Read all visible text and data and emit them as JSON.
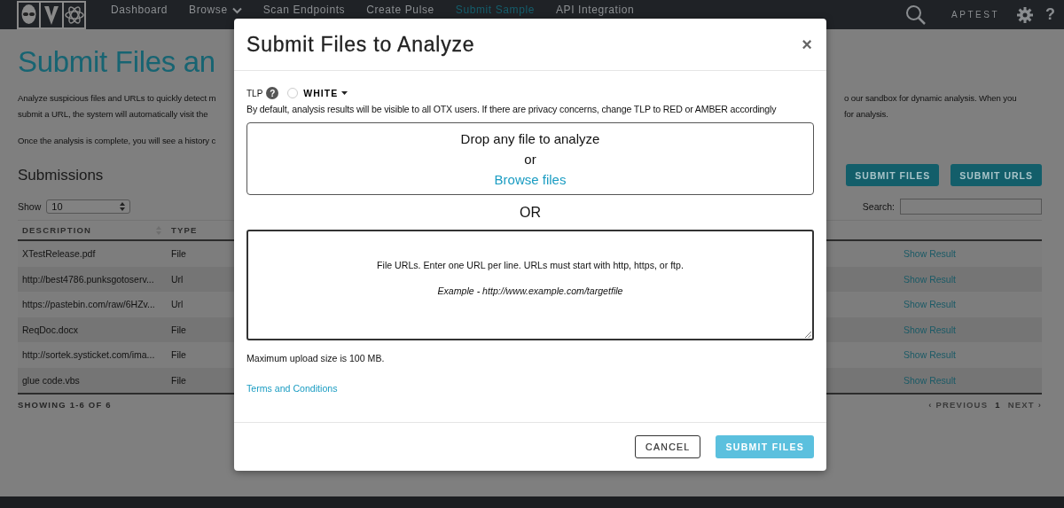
{
  "nav": {
    "items": [
      {
        "label": "Dashboard",
        "selected": false,
        "dropdown": false
      },
      {
        "label": "Browse",
        "selected": false,
        "dropdown": true
      },
      {
        "label": "Scan Endpoints",
        "selected": false,
        "dropdown": false
      },
      {
        "label": "Create Pulse",
        "selected": false,
        "dropdown": false
      },
      {
        "label": "Submit Sample",
        "selected": true,
        "dropdown": false
      },
      {
        "label": "API Integration",
        "selected": false,
        "dropdown": false
      }
    ],
    "user": "APTEST",
    "help": "?"
  },
  "page": {
    "title": "Submit Files an",
    "intro_lines": [
      {
        "left": "Analyze suspicious files and URLs to quickly detect m",
        "right": "o our sandbox for dynamic analysis. When you"
      },
      {
        "left": "submit a URL, the system will automatically visit the",
        "right": "for analysis."
      },
      {
        "left": "Once the analysis is complete, you will see a history c"
      }
    ],
    "submissions_title": "Submissions",
    "buttons": [
      "SUBMIT FILES",
      "SUBMIT URLS"
    ],
    "show_label": "Show",
    "show_value": "10",
    "search_label": "Search:",
    "table": {
      "columns": [
        "DESCRIPTION",
        "TYPE"
      ],
      "rows": [
        {
          "description": "XTestRelease.pdf",
          "type": "File",
          "action": "Show Result"
        },
        {
          "description": "http://best4786.punksgotoserv...",
          "type": "Url",
          "action": "Show Result"
        },
        {
          "description": "https://pastebin.com/raw/6HZv...",
          "type": "Url",
          "action": "Show Result"
        },
        {
          "description": "ReqDoc.docx",
          "type": "File",
          "action": "Show Result"
        },
        {
          "description": "http://sortek.systicket.com/ima...",
          "type": "File",
          "action": "Show Result"
        },
        {
          "description": "glue code.vbs",
          "type": "File",
          "action": "Show Result"
        }
      ]
    },
    "showing": "SHOWING 1-6 OF 6",
    "pagination": {
      "previous": "‹ PREVIOUS",
      "page": "1",
      "next": "NEXT ›"
    }
  },
  "modal": {
    "title": "Submit Files to Analyze",
    "close": "×",
    "tlp": {
      "label": "TLP",
      "help": "?",
      "value": "WHITE",
      "checked": false
    },
    "note": "By default, analysis results will be visible to all OTX users. If there are privacy concerns, change TLP to RED or AMBER accordingly",
    "dropzone": {
      "line": "Drop any file to analyze",
      "or": "or",
      "browse": "Browse files"
    },
    "separator": "OR",
    "url_field": {
      "placeholder": "File URLs. Enter one URL per line. URLs must start with http, https, or ftp.",
      "example": "Example - http://www.example.com/targetfile"
    },
    "max_size": "Maximum upload size is 100 MB.",
    "terms": "Terms and Conditions",
    "buttons": [
      {
        "label": "CANCEL",
        "kind": "secondary"
      },
      {
        "label": "SUBMIT FILES",
        "kind": "primary"
      }
    ]
  }
}
